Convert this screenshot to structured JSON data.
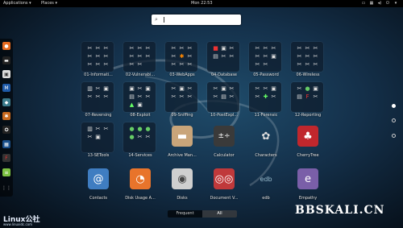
{
  "topbar": {
    "applications": "Applications ▾",
    "places": "Places ▾",
    "clock": "Mon 22:53"
  },
  "search": {
    "placeholder": ""
  },
  "dash_icons": [
    "firefox-icon",
    "terminal-icon",
    "folder-icon",
    "metasploit-icon",
    "armitage-icon",
    "burp-icon",
    "maltego-icon",
    "beef-icon",
    "faraday-icon",
    "leafpad-icon",
    "app-grid-icon"
  ],
  "apps": {
    "a01": "01-Informati...",
    "a02": "02-Vulnerabi...",
    "a03": "03-WebApps",
    "a04": "04-Database",
    "a05": "05-Password",
    "a06": "06-Wireless",
    "a07": "07-Reversing",
    "a08": "08-Exploit",
    "a09": "09-Sniffing",
    "a10": "10-PostExpl...",
    "a11": "11-Forensic",
    "a12": "12-Reporting",
    "a13": "13-SETools",
    "a14": "14-Services",
    "a15": "Archive Man...",
    "a16": "Calculator",
    "a17": "Characters",
    "a18": "CherryTree",
    "a19": "Contacts",
    "a20": "Disk Usage A...",
    "a21": "Disks",
    "a22": "Document V...",
    "a23": "edb",
    "a24": "Empathy"
  },
  "tabs": {
    "frequent": "Frequent",
    "all": "All"
  },
  "watermark": {
    "linux": "Linux公社",
    "linux_sub": "www.linuxidc.com",
    "bbskali": "BBSKALI.CN"
  }
}
